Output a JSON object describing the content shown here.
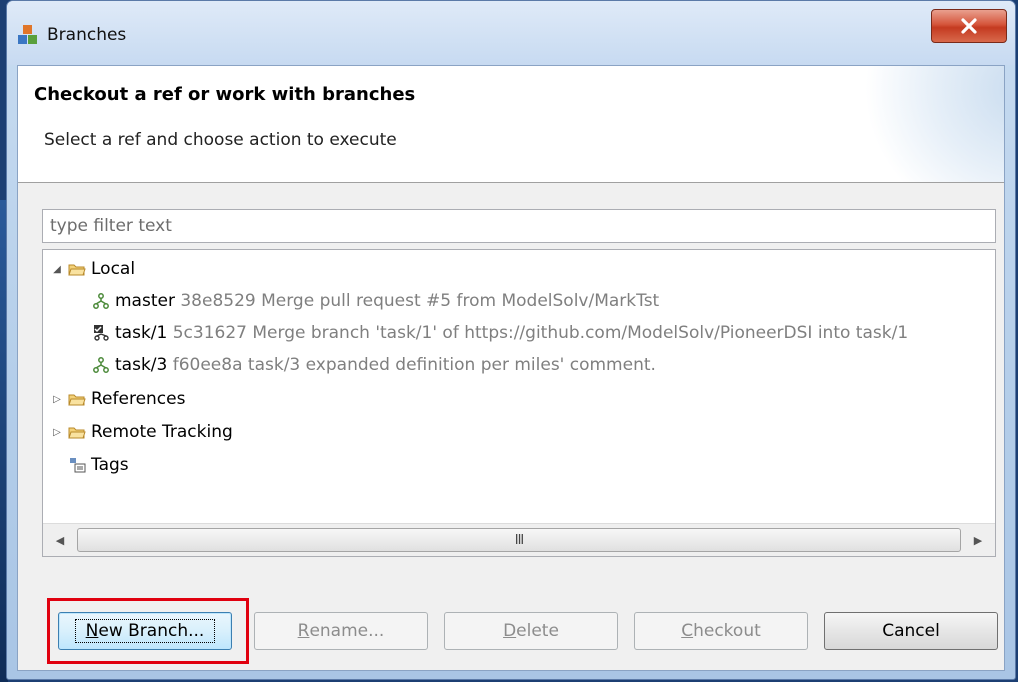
{
  "window": {
    "title": "Branches"
  },
  "header": {
    "title": "Checkout a ref or work with branches",
    "subtitle": "Select a ref and choose action to execute"
  },
  "filter": {
    "placeholder": "type filter text",
    "value": ""
  },
  "tree": {
    "local": {
      "label": "Local",
      "expanded": true,
      "branches": [
        {
          "name": "master",
          "detail": "38e8529 Merge pull request #5 from ModelSolv/MarkTst",
          "checked_out": false
        },
        {
          "name": "task/1",
          "detail": "5c31627 Merge branch 'task/1' of https://github.com/ModelSolv/PioneerDSI into task/1",
          "checked_out": true
        },
        {
          "name": "task/3",
          "detail": "f60ee8a task/3 expanded definition per miles' comment.",
          "checked_out": false
        }
      ]
    },
    "references": {
      "label": "References",
      "expanded": false
    },
    "remote_tracking": {
      "label": "Remote Tracking",
      "expanded": false
    },
    "tags": {
      "label": "Tags"
    },
    "scrollbar_thumb_glyph": "III"
  },
  "buttons": {
    "new_branch": {
      "mnemonic": "N",
      "rest": "ew Branch...",
      "enabled": true
    },
    "rename": {
      "mnemonic": "R",
      "rest": "ename...",
      "enabled": false
    },
    "delete": {
      "mnemonic": "D",
      "rest": "elete",
      "enabled": false
    },
    "checkout": {
      "mnemonic": "C",
      "rest": "heckout",
      "enabled": false
    },
    "cancel": {
      "label": "Cancel",
      "enabled": true
    }
  },
  "colors": {
    "highlight": "#e0000f",
    "muted_text": "#7f7f7f"
  }
}
